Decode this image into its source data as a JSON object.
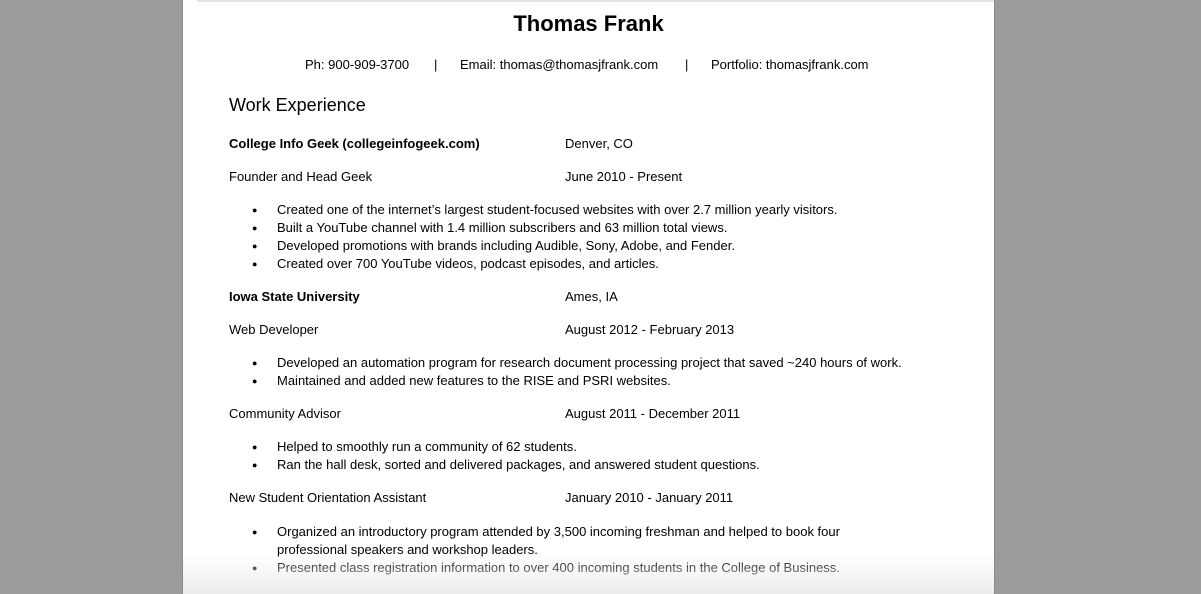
{
  "header": {
    "name": "Thomas Frank",
    "phone": "Ph: 900-909-3700",
    "separator": "|",
    "email": "Email: thomas@thomasjfrank.com",
    "portfolio": "Portfolio: thomasjfrank.com"
  },
  "work_experience": {
    "title": "Work Experience",
    "employers": [
      {
        "name": "College Info Geek (collegeinfogeek.com)",
        "location": "Denver, CO",
        "roles": [
          {
            "title": "Founder and Head Geek",
            "dates": "June 2010 - Present",
            "bullets": [
              "Created one of the internet’s largest student-focused websites with over 2.7 million yearly visitors.",
              "Built a YouTube channel with 1.4 million subscribers and 63 million total views.",
              "Developed promotions with brands including Audible, Sony, Adobe, and Fender.",
              "Created over 700 YouTube videos, podcast episodes, and articles."
            ]
          }
        ]
      },
      {
        "name": "Iowa State University",
        "location": "Ames, IA",
        "roles": [
          {
            "title": "Web Developer",
            "dates": "August 2012 - February 2013",
            "bullets": [
              "Developed an automation program for research document processing project that saved ~240 hours of work.",
              "Maintained and added new features to the RISE and PSRI websites."
            ]
          },
          {
            "title": "Community Advisor",
            "dates": "August 2011 - December 2011",
            "bullets": [
              "Helped to smoothly run a community of 62 students.",
              "Ran the hall desk, sorted and delivered packages, and answered student questions."
            ]
          },
          {
            "title": "New Student Orientation Assistant",
            "dates": "January 2010 - January 2011",
            "bullets": [
              "Organized an introductory program attended by 3,500 incoming freshman and helped to book four professional speakers and workshop leaders.",
              "Presented class registration information to over 400 incoming students in the College of  Business."
            ]
          }
        ]
      }
    ]
  }
}
